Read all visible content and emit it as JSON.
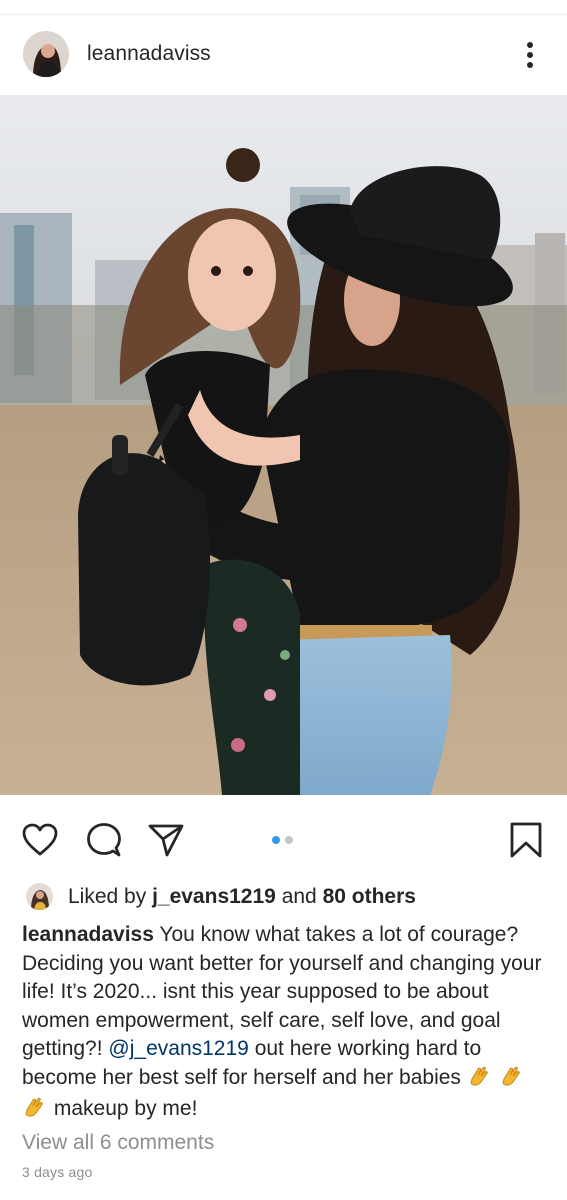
{
  "post": {
    "username": "leannadaviss",
    "liked_prefix": "Liked by",
    "liked_user": "j_evans1219",
    "liked_and": "and",
    "liked_others": "80 others",
    "caption_user": "leannadaviss",
    "caption_text_1": "You know what takes a lot of courage? Deciding you want better for yourself and changing your life! It’s 2020... isnt this year supposed to be about women empowerment, self care, self love, and goal getting?!",
    "caption_mention": "@j_evans1219",
    "caption_text_2": "out here working hard to become her best self for herself and her babies",
    "caption_text_3": "makeup by me!",
    "view_comments": "View all 6 comments",
    "timestamp": "3 days ago",
    "carousel": {
      "count": 2,
      "active_index": 0
    }
  },
  "icons": {
    "more": "more-vertical-icon",
    "like": "heart-icon",
    "comment": "comment-icon",
    "share": "paper-plane-icon",
    "save": "bookmark-icon",
    "clap": "clapping-hands-emoji"
  },
  "colors": {
    "text": "#262626",
    "secondary": "#8e8e8e",
    "mention": "#003569",
    "carousel_active": "#3897f0",
    "carousel_inactive": "#c4c4c4"
  }
}
